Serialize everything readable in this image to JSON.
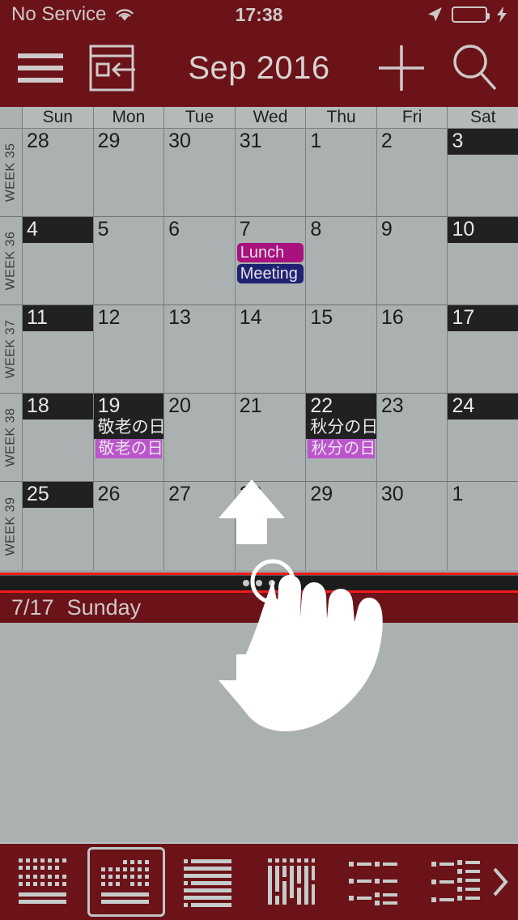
{
  "status_bar": {
    "carrier": "No Service",
    "wifi_icon": "wifi-icon",
    "time": "17:38",
    "location_icon": "location-arrow-icon",
    "battery_icon": "battery-full-icon",
    "charging_icon": "lightning-bolt-icon",
    "battery_color": "#3CB64A"
  },
  "nav_bar": {
    "menu_icon": "hamburger-menu-icon",
    "today_icon": "jump-to-today-icon",
    "title": "Sep 2016",
    "add_icon": "plus-icon",
    "search_icon": "search-icon",
    "background_color": "#6B1318"
  },
  "calendar": {
    "weekday_headers": [
      "Sun",
      "Mon",
      "Tue",
      "Wed",
      "Thu",
      "Fri",
      "Sat"
    ],
    "weeks": [
      {
        "week_label": "WEEK 35",
        "days": [
          {
            "num": "28",
            "dark": false,
            "holiday": "",
            "events": []
          },
          {
            "num": "29",
            "dark": false,
            "holiday": "",
            "events": []
          },
          {
            "num": "30",
            "dark": false,
            "holiday": "",
            "events": []
          },
          {
            "num": "31",
            "dark": false,
            "holiday": "",
            "events": []
          },
          {
            "num": "1",
            "dark": false,
            "holiday": "",
            "events": []
          },
          {
            "num": "2",
            "dark": false,
            "holiday": "",
            "events": []
          },
          {
            "num": "3",
            "dark": true,
            "holiday": "",
            "events": []
          }
        ]
      },
      {
        "week_label": "WEEK 36",
        "days": [
          {
            "num": "4",
            "dark": true,
            "holiday": "",
            "events": []
          },
          {
            "num": "5",
            "dark": false,
            "holiday": "",
            "events": []
          },
          {
            "num": "6",
            "dark": false,
            "holiday": "",
            "events": []
          },
          {
            "num": "7",
            "dark": false,
            "holiday": "",
            "events": [
              {
                "label": "Lunch",
                "color": "#A8117E",
                "flat": false
              },
              {
                "label": "Meeting",
                "color": "#1E2272",
                "flat": false
              }
            ]
          },
          {
            "num": "8",
            "dark": false,
            "holiday": "",
            "events": []
          },
          {
            "num": "9",
            "dark": false,
            "holiday": "",
            "events": []
          },
          {
            "num": "10",
            "dark": true,
            "holiday": "",
            "events": []
          }
        ]
      },
      {
        "week_label": "WEEK 37",
        "days": [
          {
            "num": "11",
            "dark": true,
            "holiday": "",
            "events": []
          },
          {
            "num": "12",
            "dark": false,
            "holiday": "",
            "events": []
          },
          {
            "num": "13",
            "dark": false,
            "holiday": "",
            "events": []
          },
          {
            "num": "14",
            "dark": false,
            "holiday": "",
            "events": []
          },
          {
            "num": "15",
            "dark": false,
            "holiday": "",
            "events": []
          },
          {
            "num": "16",
            "dark": false,
            "holiday": "",
            "events": []
          },
          {
            "num": "17",
            "dark": true,
            "holiday": "",
            "events": []
          }
        ]
      },
      {
        "week_label": "WEEK 38",
        "days": [
          {
            "num": "18",
            "dark": true,
            "holiday": "",
            "events": []
          },
          {
            "num": "19",
            "dark": true,
            "holiday": "敬老の日",
            "events": [
              {
                "label": "敬老の日",
                "color": "#BB55CC",
                "flat": true
              }
            ]
          },
          {
            "num": "20",
            "dark": false,
            "holiday": "",
            "events": []
          },
          {
            "num": "21",
            "dark": false,
            "holiday": "",
            "events": []
          },
          {
            "num": "22",
            "dark": true,
            "holiday": "秋分の日",
            "events": [
              {
                "label": "秋分の日",
                "color": "#BB55CC",
                "flat": true
              }
            ]
          },
          {
            "num": "23",
            "dark": false,
            "holiday": "",
            "events": []
          },
          {
            "num": "24",
            "dark": true,
            "holiday": "",
            "events": []
          }
        ]
      },
      {
        "week_label": "WEEK 39",
        "days": [
          {
            "num": "25",
            "dark": true,
            "holiday": "",
            "events": []
          },
          {
            "num": "26",
            "dark": false,
            "holiday": "",
            "events": []
          },
          {
            "num": "27",
            "dark": false,
            "holiday": "",
            "events": []
          },
          {
            "num": "28",
            "dark": false,
            "holiday": "",
            "events": []
          },
          {
            "num": "29",
            "dark": false,
            "holiday": "",
            "events": []
          },
          {
            "num": "30",
            "dark": false,
            "holiday": "",
            "events": []
          },
          {
            "num": "1",
            "dark": false,
            "holiday": "",
            "events": []
          }
        ]
      }
    ]
  },
  "drag_handle": {
    "grip_icon": "drag-grip-icon",
    "accent_color": "#F21B1B"
  },
  "detail_panel": {
    "date": "7/17",
    "weekday": "Sunday"
  },
  "gesture_hint": {
    "up_arrow_icon": "arrow-up-icon",
    "down_arrow_icon": "arrow-down-icon",
    "hand_icon": "pointing-hand-icon",
    "tap_ring_icon": "tap-target-ring-icon"
  },
  "toolbar": {
    "buttons": [
      {
        "icon": "view-multi-month-icon",
        "selected": false
      },
      {
        "icon": "view-month-icon",
        "selected": true
      },
      {
        "icon": "view-list-rows-icon",
        "selected": false
      },
      {
        "icon": "view-week-columns-icon",
        "selected": false
      },
      {
        "icon": "view-agenda-icon",
        "selected": false
      },
      {
        "icon": "view-agenda-detail-icon",
        "selected": false
      }
    ],
    "more_icon": "chevron-right-icon"
  }
}
